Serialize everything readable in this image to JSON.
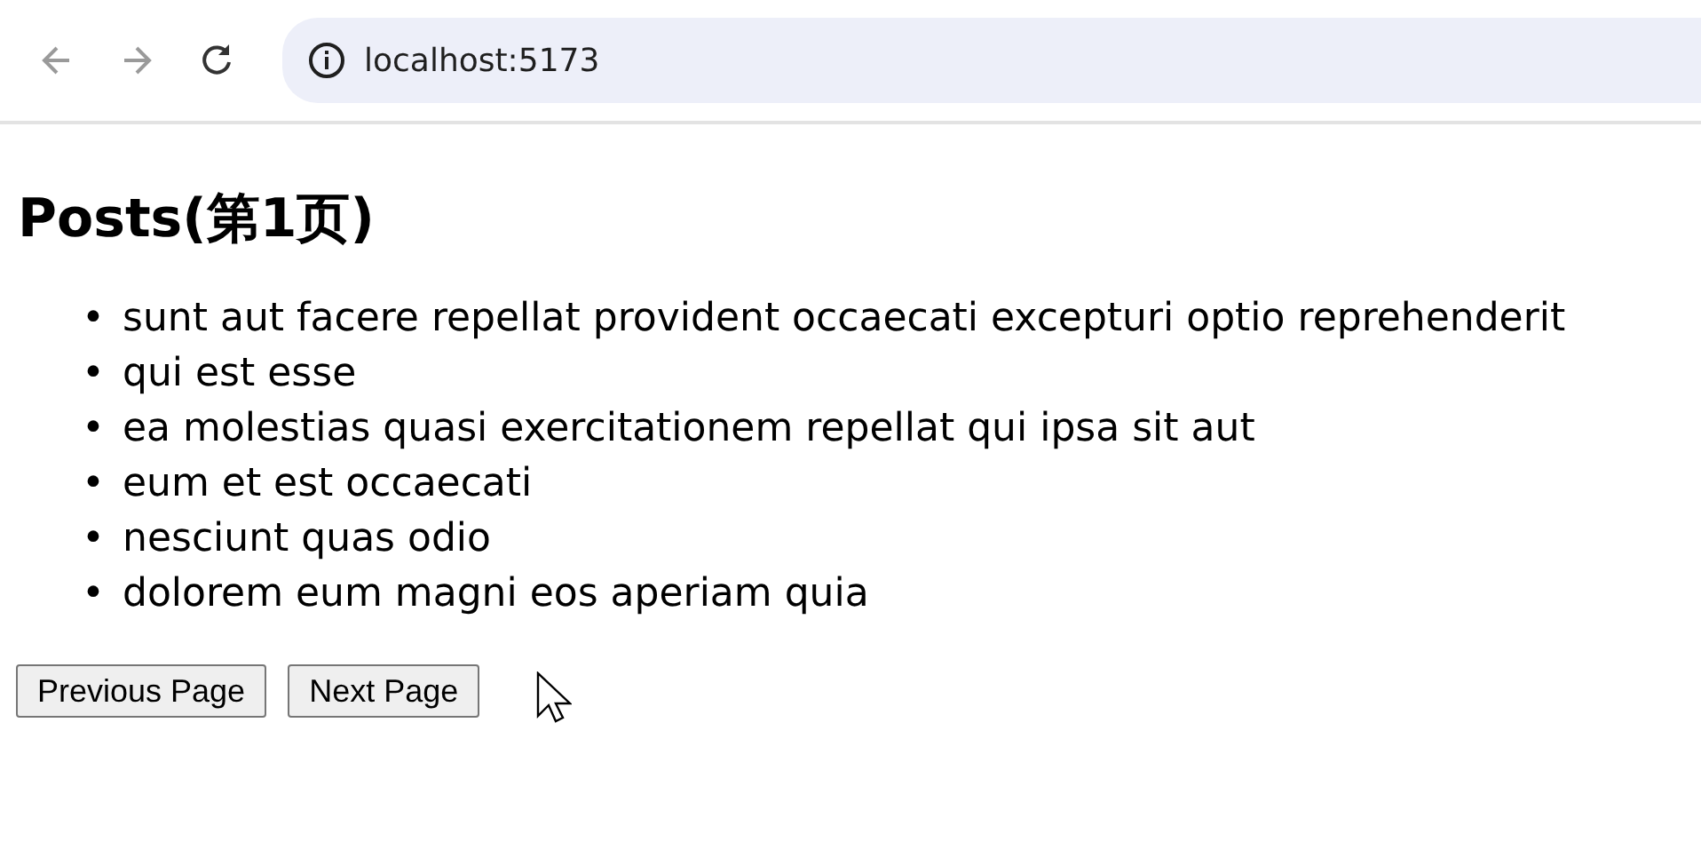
{
  "browser": {
    "back": {
      "disabled": true
    },
    "forward": {
      "disabled": true
    },
    "address": "localhost:5173"
  },
  "heading": "Posts(第1页)",
  "posts": [
    {
      "marker": "•",
      "title": "sunt aut facere repellat provident occaecati excepturi optio reprehenderit"
    },
    {
      "marker": "•",
      "title": "qui est esse"
    },
    {
      "marker": "•",
      "title": "ea molestias quasi exercitationem repellat qui ipsa sit aut"
    },
    {
      "marker": "•",
      "title": "eum et est occaecati"
    },
    {
      "marker": "•",
      "title": "nesciunt quas odio"
    },
    {
      "marker": "•",
      "title": "dolorem eum magni eos aperiam quia"
    }
  ],
  "buttons": [
    "Previous Page",
    "Next Page"
  ]
}
